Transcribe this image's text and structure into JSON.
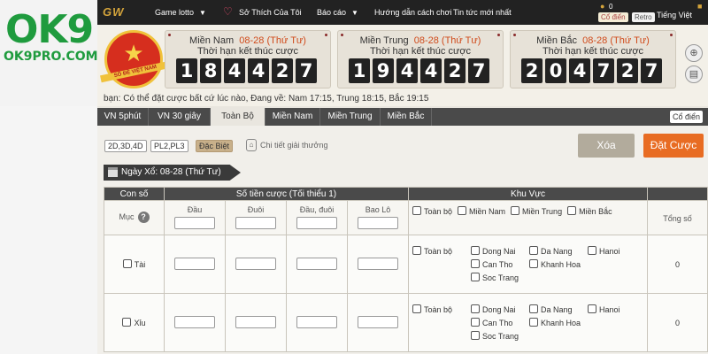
{
  "logo": {
    "main": "OK9",
    "sub": "OK9PRO.COM"
  },
  "topnav": {
    "brand": "GW",
    "items": [
      "Game lotto",
      "Sở Thích Của Tôi",
      "Báo cáo",
      "Hướng dẫn cách chơi",
      "Tin tức mới nhất"
    ],
    "account_count": "0",
    "btn_codien": "Cổ điển",
    "btn_retro": "Retro",
    "lang": "Tiếng Việt"
  },
  "banner": {
    "badge_label": "SỔ ĐỀ VIỆT NAM",
    "deadline_label": "Thời hạn kết thúc cược",
    "regions": [
      {
        "name": "Miền Nam",
        "date": "08-28 (Thứ Tư)",
        "digits": [
          "1",
          "8",
          "4",
          "4",
          "2",
          "7"
        ]
      },
      {
        "name": "Miền Trung",
        "date": "08-28 (Thứ Tư)",
        "digits": [
          "1",
          "9",
          "4",
          "4",
          "2",
          "7"
        ]
      },
      {
        "name": "Miền Bắc",
        "date": "08-28 (Thứ Tư)",
        "digits": [
          "2",
          "0",
          "4",
          "7",
          "2",
          "7"
        ]
      }
    ]
  },
  "marquee": "bạn: Có thể đặt cược bất cứ lúc nào,   Đang về: Nam 17:15, Trung 18:15, Bắc 19:15",
  "tabs": [
    "VN 5phút",
    "VN 30 giây",
    "Toàn Bộ",
    "Miền Nam",
    "Miền Trung",
    "Miền Bắc"
  ],
  "active_tab": "Toàn Bộ",
  "btn_codien": "Cổ điển",
  "filters": [
    "2D,3D,4D",
    "PL2,PL3",
    "Đặc Biệt"
  ],
  "prize_detail": "Chi tiết giải thưởng",
  "btn_clear": "Xóa",
  "btn_bet": "Đặt Cược",
  "draw_date": "Ngày Xổ:  08-28 (Thứ Tư)",
  "table": {
    "h_conso": "Con số",
    "h_sotien": "Số tiền cược (Tối thiểu 1)",
    "h_khuvuc": "Khu Vực",
    "h_muc": "Mục",
    "sub_dau": "Đầu",
    "sub_duoi": "Đuôi",
    "sub_dauduoi": "Đầu, đuôi",
    "sub_baolo": "Bao Lô",
    "region_all": "Toàn bộ",
    "region_nam": "Miền Nam",
    "region_trung": "Miền Trung",
    "region_bac": "Miền Bắc",
    "h_tongso": "Tổng số",
    "rows": [
      {
        "label": "Tài",
        "total": "0",
        "provinces": [
          "Toàn bộ",
          "Dong Nai",
          "Da Nang",
          "Hanoi",
          "",
          "Can Tho",
          "Khanh Hoa",
          "",
          "",
          "Soc Trang",
          "",
          ""
        ]
      },
      {
        "label": "Xỉu",
        "total": "0",
        "provinces": [
          "Toàn bộ",
          "Dong Nai",
          "Da Nang",
          "Hanoi",
          "",
          "Can Tho",
          "Khanh Hoa",
          "",
          "",
          "Soc Trang",
          "",
          ""
        ]
      }
    ]
  }
}
